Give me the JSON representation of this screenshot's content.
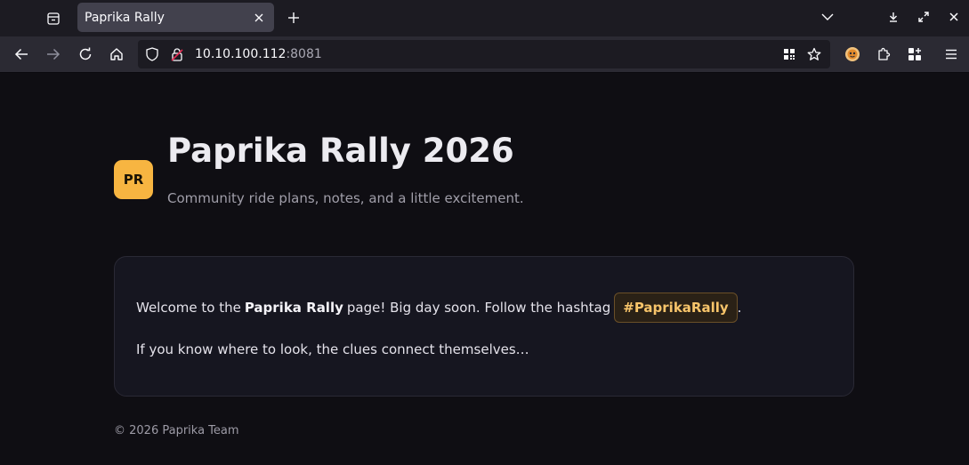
{
  "browser": {
    "tab": {
      "title": "Paprika Rally",
      "close_icon": "close-icon"
    },
    "new_tab_icon": "plus-icon",
    "url": {
      "host": "10.10.100.112",
      "port": ":8081"
    },
    "toolbar_icons": [
      "back-arrow-icon",
      "forward-arrow-icon",
      "reload-icon",
      "home-icon"
    ],
    "url_icons": [
      "shield-icon",
      "lock-icon",
      "qr-code-icon",
      "star-icon"
    ],
    "right_icons": [
      "extension-avatar-icon",
      "puzzle-icon",
      "extensions-grid-icon",
      "menu-icon"
    ],
    "window_icons": [
      "list-tabs-chevron-icon",
      "download-icon",
      "fullscreen-icon",
      "close-window-icon"
    ]
  },
  "page": {
    "logo": {
      "initials": "PR",
      "color": "#f7b541"
    },
    "title": "Paprika Rally 2026",
    "subtitle": "Community ride plans, notes, and a little excitement.",
    "card": {
      "line1_prefix": "Welcome to the",
      "line1_bold": "Paprika Rally",
      "line1_middle": "page! Big day soon. Follow the hashtag",
      "hashtag": "#PaprikaRally",
      "line1_suffix": ".",
      "line2": "If you know where to look, the clues connect themselves…"
    },
    "footer": "© 2026 Paprika Team"
  }
}
